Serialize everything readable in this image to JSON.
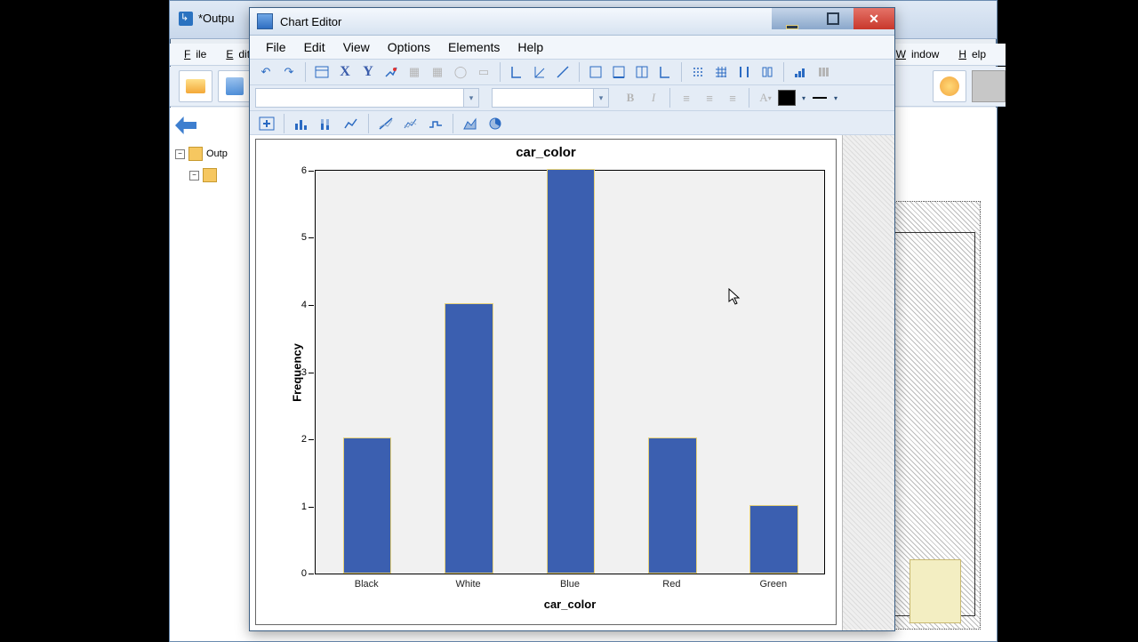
{
  "parent_window": {
    "title": "*Outpu",
    "menu_partial_left": [
      "File",
      "Edit"
    ],
    "menu_partial_right": [
      "Window",
      "Help"
    ],
    "tree_root": "Outp"
  },
  "editor": {
    "title": "Chart Editor",
    "menu": {
      "file": "File",
      "edit": "Edit",
      "view": "View",
      "options": "Options",
      "elements": "Elements",
      "help": "Help"
    },
    "winbtn": {
      "min": "Minimize",
      "max": "Maximize",
      "close": "Close"
    }
  },
  "toolbar": {
    "undo": "Undo",
    "redo": "Redo",
    "props": "Properties",
    "x": "X",
    "y": "Y",
    "bold": "B",
    "italic": "I"
  },
  "chart_data": {
    "type": "bar",
    "title": "car_color",
    "xlabel": "car_color",
    "ylabel": "Frequency",
    "ylim": [
      0,
      6
    ],
    "yticks": [
      0,
      1,
      2,
      3,
      4,
      5,
      6
    ],
    "categories": [
      "Black",
      "White",
      "Blue",
      "Red",
      "Green"
    ],
    "values": [
      2,
      4,
      6,
      2,
      1
    ],
    "bar_color": "#3b5fb0",
    "bar_border": "#e7d27a"
  }
}
